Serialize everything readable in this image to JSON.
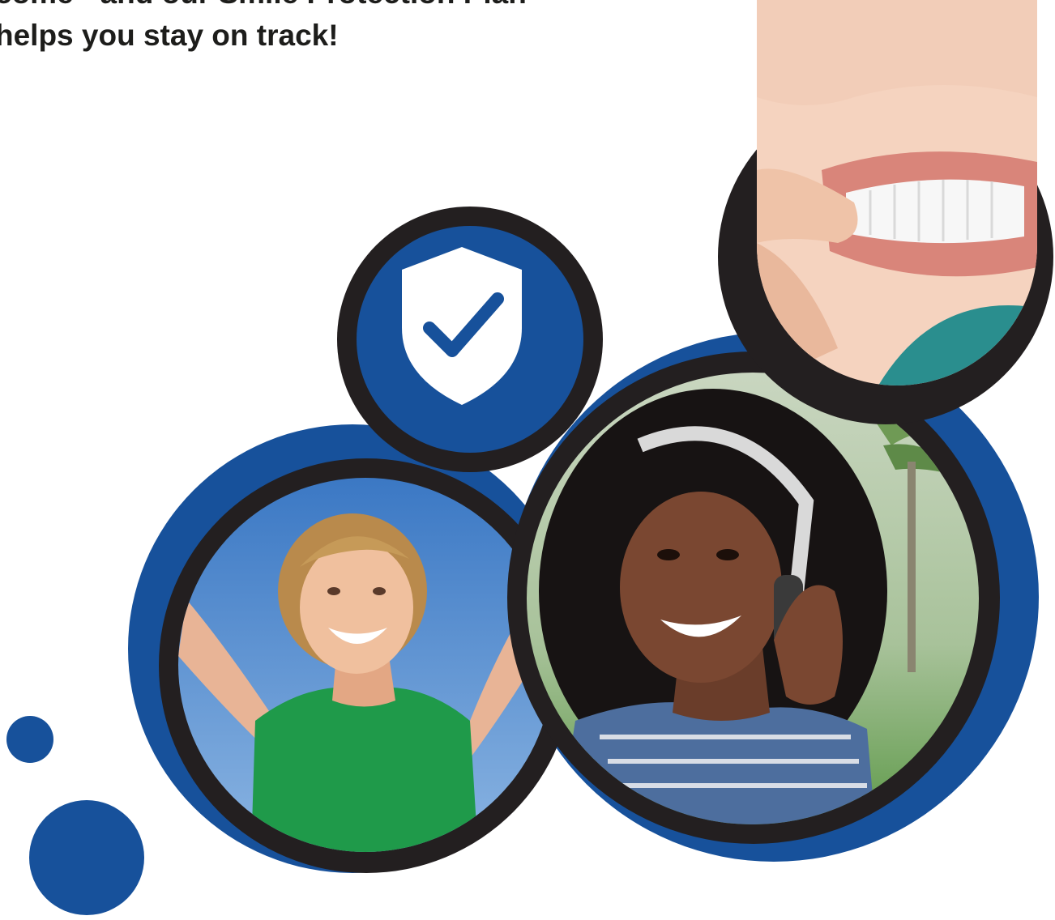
{
  "heading": {
    "line1": "come - and our Smile Protection Plan",
    "line2": "helps you stay on track!"
  },
  "colors": {
    "brand_blue": "#17519b",
    "ring_dark": "#231f20",
    "text_dark": "#1d1d1b",
    "white": "#ffffff"
  },
  "icons": {
    "shield": "shield-check-icon"
  },
  "images": {
    "aligner": "aligner-photo",
    "woman": "woman-with-headphones-photo",
    "boy": "boy-with-raised-arms-photo"
  }
}
